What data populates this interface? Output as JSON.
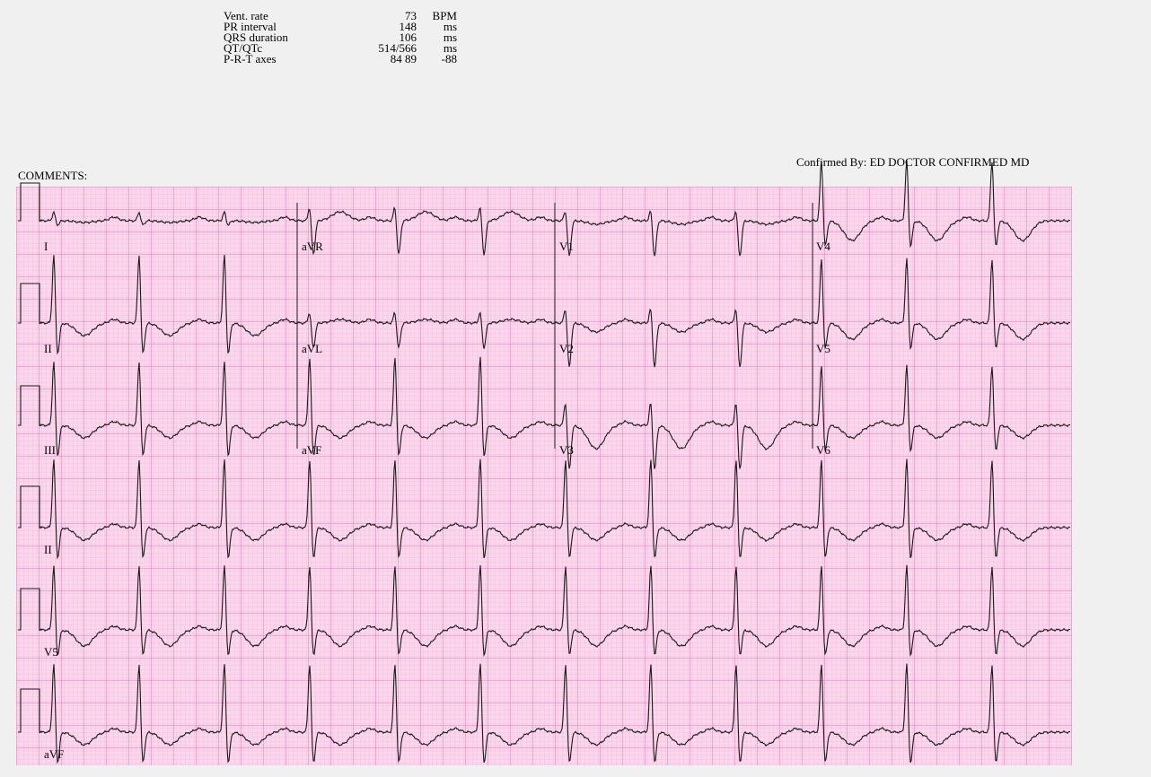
{
  "measurements": [
    {
      "label": "Vent. rate",
      "value": "73",
      "unit": "BPM"
    },
    {
      "label": "PR interval",
      "value": "148",
      "unit": "ms"
    },
    {
      "label": "QRS duration",
      "value": "106",
      "unit": "ms"
    },
    {
      "label": "QT/QTc",
      "value": "514/566",
      "unit": "ms"
    },
    {
      "label": "P-R-T axes",
      "value": "84  89",
      "unit": "-88"
    }
  ],
  "comments_label": "COMMENTS:",
  "confirmed_by": "Confirmed By:  ED DOCTOR CONFIRMED MD",
  "grid": {
    "major_color": "#e07fb8",
    "minor_color": "#f4c4e2",
    "paper_color": "#fbd8ee"
  },
  "trace_color": "#1a1a1a",
  "leads": {
    "row1": [
      "I",
      "aVR",
      "V1",
      "V4"
    ],
    "row2": [
      "II",
      "aVL",
      "V2",
      "V5"
    ],
    "row3": [
      "III",
      "aVF",
      "V3",
      "V6"
    ],
    "rhythm": [
      "II",
      "V5",
      "aVF"
    ]
  }
}
